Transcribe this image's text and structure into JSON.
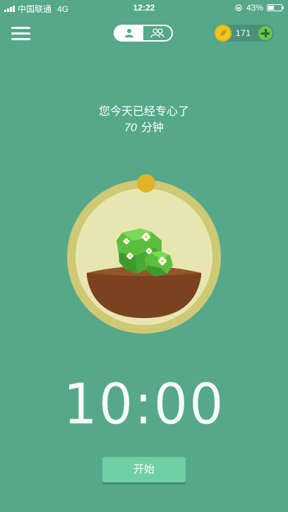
{
  "status_bar": {
    "carrier": "中国联通",
    "network": "4G",
    "time": "12:22",
    "battery": "43%",
    "battery_level": 0.43
  },
  "header": {
    "menu_icon": "menu-icon",
    "modes": [
      {
        "name": "single-user-icon",
        "active": true
      },
      {
        "name": "group-users-icon",
        "active": false
      }
    ],
    "coins": "171",
    "coin_icon": "coin-icon",
    "add_icon": "plus-icon"
  },
  "message": {
    "line1": "您今天已经专心了",
    "minutes": "70",
    "unit": "分钟"
  },
  "timer": "10:00",
  "start_button": "开始",
  "colors": {
    "background": "#56a88a",
    "button": "#6fcfa5",
    "coin": "#f3c623",
    "add": "#6ec447"
  }
}
